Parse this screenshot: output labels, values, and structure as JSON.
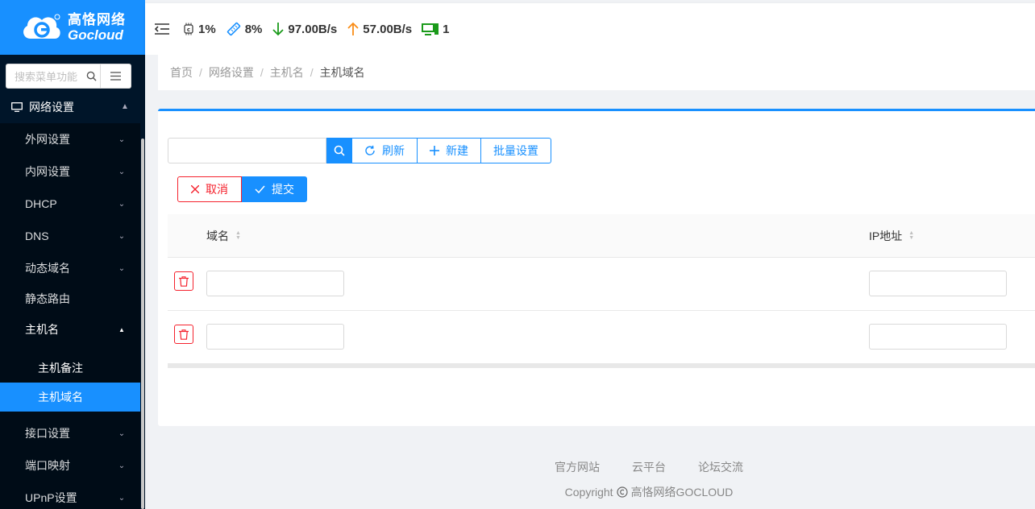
{
  "brand": {
    "name_cn": "高恪网络",
    "name_en": "Gocloud",
    "color": "#1890ff"
  },
  "header": {
    "cpu": "1%",
    "memory": "8%",
    "download": "97.00B/s",
    "upload": "57.00B/s",
    "devices": "1",
    "icons": [
      "menu-fold-icon",
      "cpu-icon",
      "memory-icon",
      "arrow-down-icon",
      "arrow-up-icon",
      "monitor-icon"
    ]
  },
  "sidebar": {
    "search_placeholder": "搜索菜单功能",
    "section": "网络设置",
    "items": [
      {
        "label": "外网设置"
      },
      {
        "label": "内网设置"
      },
      {
        "label": "DHCP"
      },
      {
        "label": "DNS"
      },
      {
        "label": "动态域名"
      },
      {
        "label": "静态路由"
      },
      {
        "label": "主机名"
      },
      {
        "label": "接口设置"
      },
      {
        "label": "端口映射"
      },
      {
        "label": "UPnP设置"
      }
    ],
    "sub_items": [
      {
        "label": "主机备注"
      },
      {
        "label": "主机域名"
      }
    ]
  },
  "breadcrumb": [
    "首页",
    "网络设置",
    "主机名",
    "主机域名"
  ],
  "toolbar": {
    "refresh": "刷新",
    "new": "新建",
    "batch": "批量设置"
  },
  "actions": {
    "cancel": "取消",
    "submit": "提交"
  },
  "table": {
    "columns": [
      "域名",
      "IP地址"
    ],
    "rows": [
      {
        "domain": "",
        "ip": ""
      },
      {
        "domain": "",
        "ip": ""
      }
    ]
  },
  "footer": {
    "links": [
      "官方网站",
      "云平台",
      "论坛交流"
    ],
    "copyright_prefix": "Copyright",
    "copyright_owner": "高恪网络GOCLOUD"
  }
}
